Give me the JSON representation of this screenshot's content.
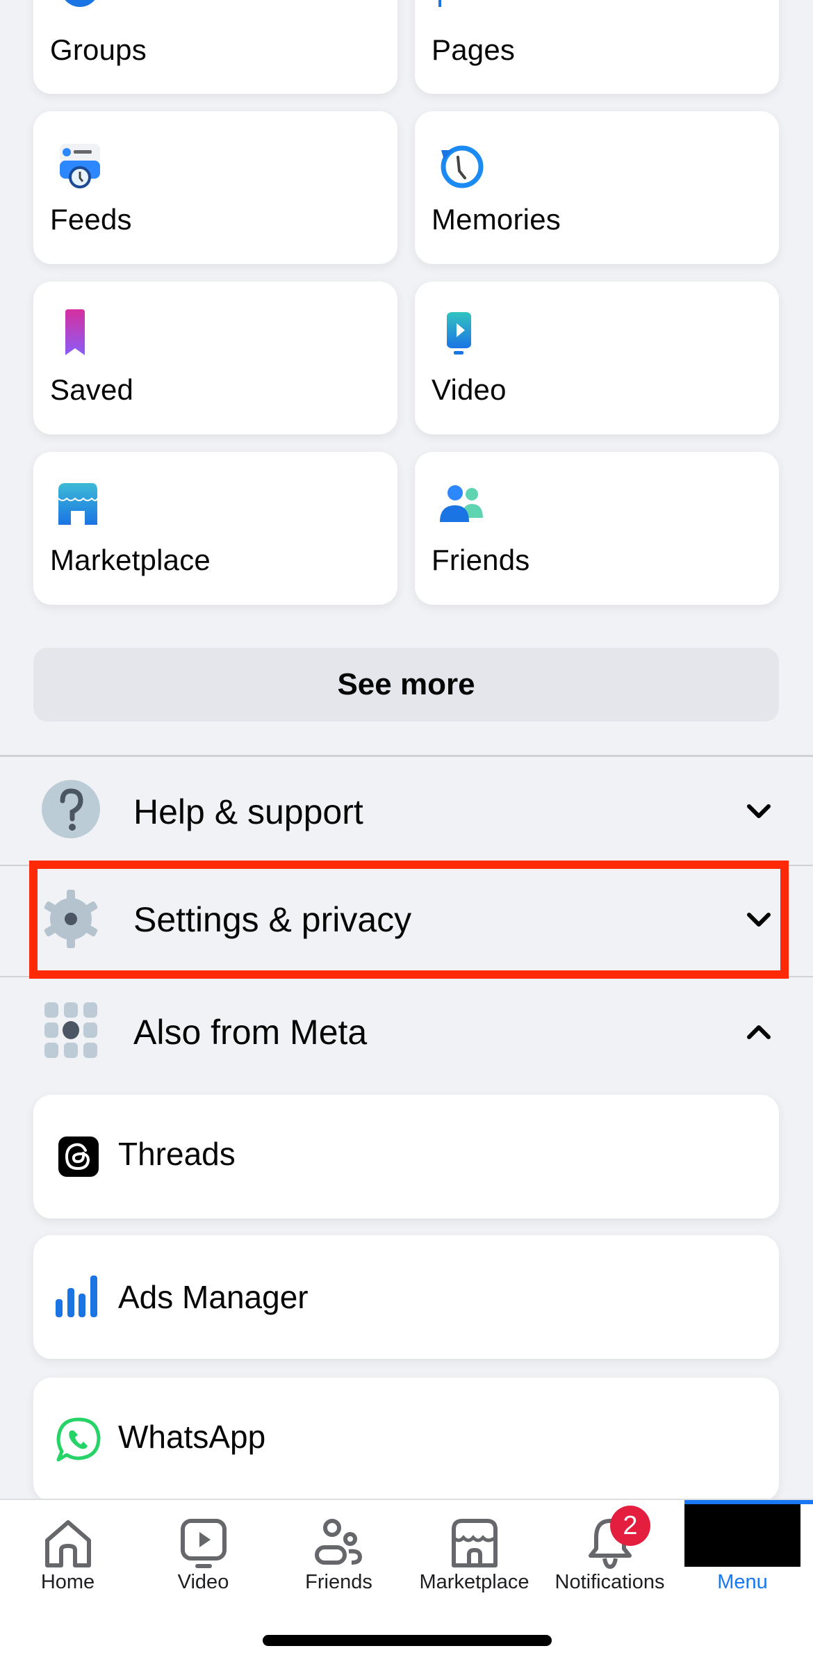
{
  "shortcuts": [
    {
      "label": "Groups",
      "icon": "groups-icon"
    },
    {
      "label": "Pages",
      "icon": "pages-flag-icon"
    },
    {
      "label": "Feeds",
      "icon": "feeds-icon"
    },
    {
      "label": "Memories",
      "icon": "memories-clock-icon"
    },
    {
      "label": "Saved",
      "icon": "saved-bookmark-icon"
    },
    {
      "label": "Video",
      "icon": "video-play-icon"
    },
    {
      "label": "Marketplace",
      "icon": "marketplace-shop-icon"
    },
    {
      "label": "Friends",
      "icon": "friends-icon"
    }
  ],
  "see_more_label": "See more",
  "sections": [
    {
      "label": "Help & support",
      "icon": "help-question-icon",
      "expanded": false
    },
    {
      "label": "Settings & privacy",
      "icon": "settings-gear-icon",
      "expanded": false,
      "highlighted": true
    },
    {
      "label": "Also from Meta",
      "icon": "meta-apps-grid-icon",
      "expanded": true
    }
  ],
  "meta_apps": [
    {
      "label": "Threads",
      "icon": "threads-icon"
    },
    {
      "label": "Ads Manager",
      "icon": "ads-manager-icon"
    },
    {
      "label": "WhatsApp",
      "icon": "whatsapp-icon"
    }
  ],
  "tabbar": {
    "tabs": [
      {
        "label": "Home",
        "icon": "home-icon"
      },
      {
        "label": "Video",
        "icon": "video-icon"
      },
      {
        "label": "Friends",
        "icon": "friends-icon"
      },
      {
        "label": "Marketplace",
        "icon": "marketplace-icon"
      },
      {
        "label": "Notifications",
        "icon": "bell-icon"
      },
      {
        "label": "Menu",
        "icon": "menu-avatar",
        "active": true
      }
    ],
    "notifications_badge": "2"
  },
  "colors": {
    "accent": "#1877f2",
    "highlight_box": "#fe2a07",
    "badge": "#e41e3f",
    "background": "#f0f2f5"
  }
}
